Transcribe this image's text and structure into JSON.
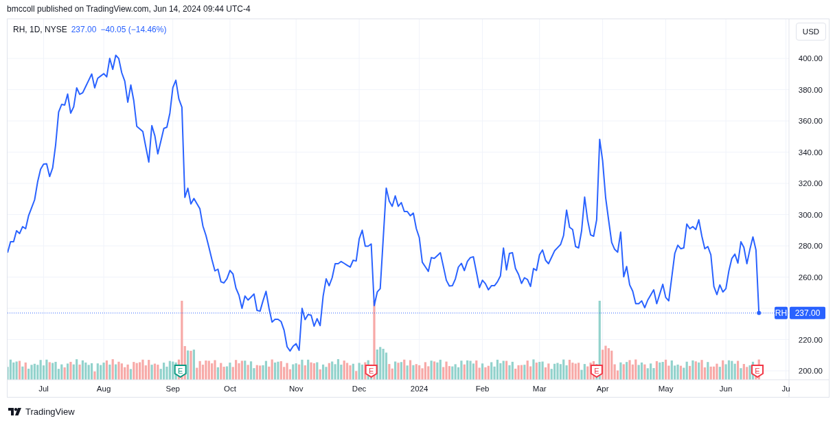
{
  "header": {
    "text": "bmccoll published on TradingView.com, Jun 14, 2024 09:44 UTC-4"
  },
  "chart": {
    "legend": {
      "symbol": "RH, 1D, NYSE",
      "price": "237.00",
      "change": "−40.05 (−14.46%)"
    },
    "currency_button": "USD",
    "last_price": {
      "symbol": "RH",
      "price": "237.00"
    },
    "earnings_markers": [
      {
        "text": "E",
        "color": "#089981"
      },
      {
        "text": "E",
        "color": "#f23645"
      },
      {
        "text": "E",
        "color": "#f23645"
      },
      {
        "text": "E",
        "color": "#f23645"
      }
    ],
    "chart_data": {
      "type": "line",
      "grid": true,
      "ylim": [
        194.3,
        425.1
      ],
      "ref_lines": [
        {
          "axis": "y",
          "value": 237
        }
      ],
      "categories": [
        null,
        null,
        null,
        null,
        null,
        null,
        null,
        null,
        null,
        null,
        null,
        null,
        "Jul",
        null,
        null,
        null,
        null,
        null,
        null,
        null,
        null,
        null,
        null,
        null,
        null,
        null,
        null,
        null,
        null,
        null,
        null,
        null,
        "Aug",
        null,
        null,
        null,
        null,
        null,
        null,
        null,
        null,
        null,
        null,
        null,
        null,
        null,
        null,
        null,
        null,
        null,
        null,
        null,
        null,
        null,
        null,
        "Sep",
        null,
        null,
        null,
        null,
        null,
        null,
        null,
        null,
        null,
        null,
        null,
        null,
        null,
        null,
        null,
        null,
        null,
        null,
        "Oct",
        null,
        null,
        null,
        null,
        null,
        null,
        null,
        null,
        null,
        null,
        null,
        null,
        null,
        null,
        null,
        null,
        null,
        null,
        null,
        null,
        null,
        "Nov",
        null,
        null,
        null,
        null,
        null,
        null,
        null,
        null,
        null,
        null,
        null,
        null,
        null,
        null,
        null,
        null,
        null,
        null,
        null,
        null,
        "Dec",
        null,
        null,
        null,
        null,
        null,
        null,
        null,
        null,
        null,
        null,
        null,
        null,
        null,
        null,
        null,
        null,
        null,
        null,
        null,
        "2024",
        null,
        null,
        null,
        null,
        null,
        null,
        null,
        null,
        null,
        null,
        null,
        null,
        null,
        null,
        null,
        null,
        null,
        null,
        null,
        null,
        "Feb",
        null,
        null,
        null,
        null,
        null,
        null,
        null,
        null,
        null,
        null,
        null,
        null,
        null,
        null,
        null,
        null,
        null,
        null,
        "Mar",
        null,
        null,
        null,
        null,
        null,
        null,
        null,
        null,
        null,
        null,
        null,
        null,
        null,
        null,
        null,
        null,
        null,
        null,
        null,
        null,
        "Apr",
        null,
        null,
        null,
        null,
        null,
        null,
        null,
        null,
        null,
        null,
        null,
        null,
        null,
        null,
        null,
        null,
        null,
        null,
        null,
        null,
        "May",
        null,
        null,
        null,
        null,
        null,
        null,
        null,
        null,
        null,
        null,
        null,
        null,
        null,
        null,
        null,
        null,
        null,
        null,
        null,
        "Jun",
        null,
        null,
        null,
        null,
        null,
        null,
        null,
        null,
        null,
        null,
        null,
        null,
        null,
        null,
        null,
        null,
        null,
        null,
        null,
        "Ju"
      ],
      "yticks": [
        {
          "value": 200,
          "label": "200.00"
        },
        {
          "value": 220,
          "label": "220.00"
        },
        {
          "value": 260,
          "label": "260.00"
        },
        {
          "value": 280,
          "label": "280.00"
        },
        {
          "value": 300,
          "label": "300.00"
        },
        {
          "value": 320,
          "label": "320.00"
        },
        {
          "value": 340,
          "label": "340.00"
        },
        {
          "value": 360,
          "label": "360.00"
        },
        {
          "value": 380,
          "label": "380.00"
        },
        {
          "value": 400,
          "label": "400.00"
        }
      ],
      "series": [
        {
          "color": "#2962ff",
          "values": [
            275.6,
            282.6,
            282.6,
            289.7,
            287.9,
            292.3,
            291,
            299.3,
            304.4,
            309.5,
            321,
            329,
            332.3,
            332.5,
            324.4,
            330,
            344.6,
            365.7,
            370.6,
            370.2,
            377.2,
            365,
            369,
            381.2,
            377,
            378,
            382,
            386,
            390,
            381.2,
            387.3,
            388.8,
            390.3,
            388.2,
            400,
            393,
            402,
            400,
            390.8,
            385.5,
            372,
            383,
            373,
            356.5,
            354.9,
            353.2,
            343.4,
            333.6,
            357,
            350.5,
            338.9,
            347,
            355.2,
            356,
            365,
            381.3,
            386,
            374,
            368.8,
            311,
            316.9,
            306.8,
            310.3,
            307,
            303.7,
            292.7,
            286.7,
            279,
            271.2,
            264,
            265.1,
            257,
            256.3,
            259,
            264.3,
            262,
            253,
            248.4,
            240,
            247.9,
            245.3,
            247.2,
            249.2,
            238.7,
            238.2,
            244.8,
            250.9,
            240,
            231.2,
            233,
            233,
            231.6,
            226,
            215.4,
            212.7,
            215.7,
            217.4,
            213.1,
            240,
            232.8,
            236,
            235.6,
            228.6,
            233.4,
            229,
            247.9,
            258.9,
            254.5,
            259.6,
            268.6,
            268.6,
            270,
            268.8,
            267.6,
            266.4,
            270.8,
            270.3,
            284.5,
            290,
            279.8,
            279.8,
            281.2,
            241.8,
            250.5,
            252.6,
            284.8,
            317,
            308.6,
            305.3,
            312,
            305.3,
            307.7,
            302,
            302,
            299.3,
            301,
            291,
            285.3,
            269.5,
            266.6,
            263.7,
            272.5,
            272,
            273.8,
            275.6,
            266.8,
            258,
            254.3,
            254.5,
            258.9,
            266.4,
            268.8,
            264.2,
            270.1,
            272.5,
            273,
            263.2,
            253.3,
            258,
            255.8,
            251.9,
            254.5,
            254.5,
            257,
            260.8,
            278.6,
            264.6,
            275.2,
            275.6,
            265.5,
            261.8,
            256,
            259.6,
            258.4,
            254,
            265.5,
            264.3,
            274.3,
            277.4,
            270.8,
            268.6,
            272.7,
            276.8,
            278.9,
            280.9,
            286.6,
            302.9,
            291.9,
            290.5,
            279.6,
            278.7,
            289.7,
            311.2,
            296.7,
            287,
            286.2,
            296.7,
            348.2,
            334.5,
            310.8,
            296.3,
            282.2,
            277.8,
            276,
            288.8,
            260.2,
            266.8,
            255,
            251,
            243,
            243,
            244.8,
            240.4,
            245.3,
            248.6,
            251.9,
            243,
            249.2,
            255.4,
            247,
            244.8,
            260,
            275.2,
            280.4,
            278.2,
            278.7,
            294,
            291,
            292.3,
            290.5,
            296.7,
            286.2,
            278.2,
            279.6,
            274.3,
            254,
            248.8,
            255,
            250.5,
            252.6,
            264.1,
            272,
            274.7,
            269,
            282.6,
            279,
            268.6,
            277.8,
            285.7,
            277.4,
            237,
            null,
            null,
            null,
            null,
            null,
            null,
            null,
            null,
            null
          ]
        }
      ]
    }
  },
  "footer": {
    "brand": "TradingView"
  }
}
